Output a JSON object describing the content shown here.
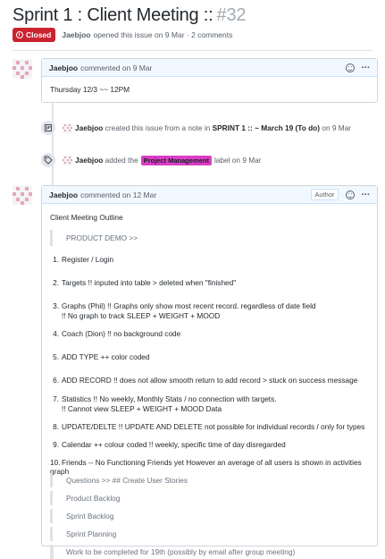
{
  "header": {
    "title": "Sprint 1 : Client Meeting ::",
    "number": "#32",
    "status": "Closed",
    "author": "Jaebjoo",
    "meta_text": "opened this issue on 9 Mar · 2 comments"
  },
  "comment1": {
    "author": "Jaebjoo",
    "date_text": "commented on 9 Mar",
    "body": "Thursday 12/3 ~~ 12PM"
  },
  "event1": {
    "icon": "project-icon",
    "author": "Jaebjoo",
    "text1": "created this issue from a note in",
    "project": "SPRINT 1 :: ~ March 19",
    "column": "(To do)",
    "date": "on 9 Mar"
  },
  "event2": {
    "icon": "tag-icon",
    "author": "Jaebjoo",
    "text1": "added the",
    "label": "Project Management",
    "label_color": "#d93fc6",
    "text2": "label on 9 Mar"
  },
  "comment2": {
    "author": "Jaebjoo",
    "date_text": "commented on 12 Mar",
    "author_tag": "Author",
    "heading": "Client Meeting Outline",
    "demo_quote": "PRODUCT DEMO >>",
    "items": [
      {
        "num": "1.",
        "text": "Register / Login",
        "sub": ""
      },
      {
        "num": "2.",
        "text": "Targets !! inputed into table > deleted when \"finished\"",
        "sub": ""
      },
      {
        "num": "3.",
        "text": "Graphs (Phil) !! Graphs only show most recent record. regardless of date field",
        "sub": "!! No graph to track SLEEP + WEIGHT + MOOD"
      },
      {
        "num": "4.",
        "text": "Coach (Dion) !! no background code",
        "sub": ""
      },
      {
        "num": "5.",
        "text": "ADD TYPE ++ color coded",
        "sub": ""
      },
      {
        "num": "6.",
        "text": "ADD RECORD !! does not allow smooth return to add record > stuck on success message",
        "sub": ""
      },
      {
        "num": "7.",
        "text": "Statistics !! No weekly, Monthly Stats / no connection with targets.",
        "sub": "!! Cannot view SLEEP + WEIGHT + MOOD Data"
      },
      {
        "num": "8.",
        "text": "UPDATE/DELTE !! UPDATE AND DELETE not possible for individual records / only for types",
        "sub": ""
      },
      {
        "num": "9.",
        "text": "Calendar ++ colour coded !! weekly, specific time of day disregarded",
        "sub": ""
      },
      {
        "num": "10.",
        "text": "Friends -- No Functioning Friends yet However an average of all users is shown in activities graph",
        "sub": ""
      }
    ],
    "quotes": [
      "Questions >> ## Create User Stories",
      "Product Backlog",
      "Sprint Backlog",
      "Sprint Planning",
      "Work to be completed for 19th (possibly by email after group meeting)"
    ]
  }
}
